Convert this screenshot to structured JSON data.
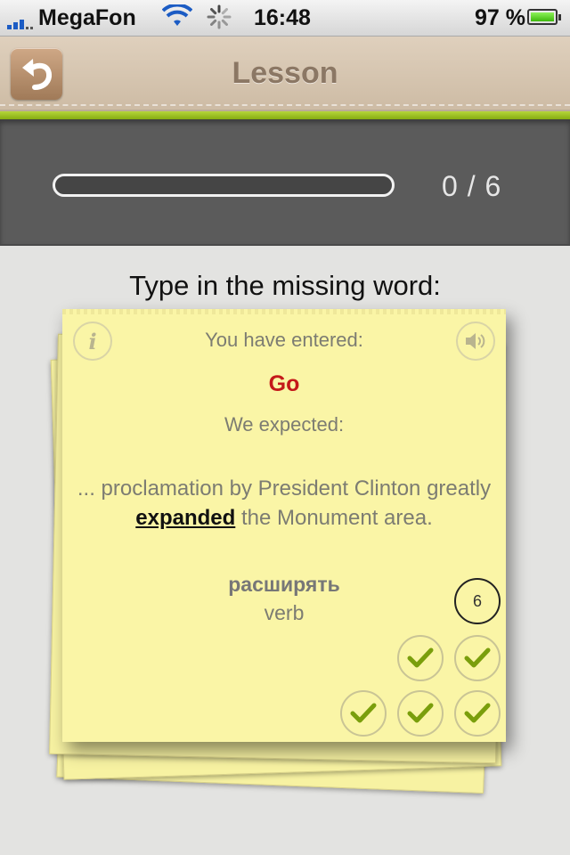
{
  "status_bar": {
    "carrier": "MegaFon",
    "time": "16:48",
    "battery_percent": "97 %"
  },
  "nav": {
    "title": "Lesson",
    "back_icon": "back-arrow-icon"
  },
  "progress": {
    "count_text": "0 / 6",
    "fraction": 0
  },
  "lesson": {
    "instruction": "Type in the missing word:",
    "entered_label": "You have entered:",
    "entered_value": "Go",
    "expected_label": "We expected:",
    "sentence_before": "... proclamation by President Clinton greatly ",
    "keyword": "expanded",
    "sentence_after": " the Monument area.",
    "translation": "расширять",
    "part_of_speech": "verb",
    "repetition_count": "6",
    "checks": 5
  },
  "colors": {
    "accent_green": "#86ac12",
    "error_red": "#c4191a",
    "card_yellow": "#faf5a6"
  }
}
